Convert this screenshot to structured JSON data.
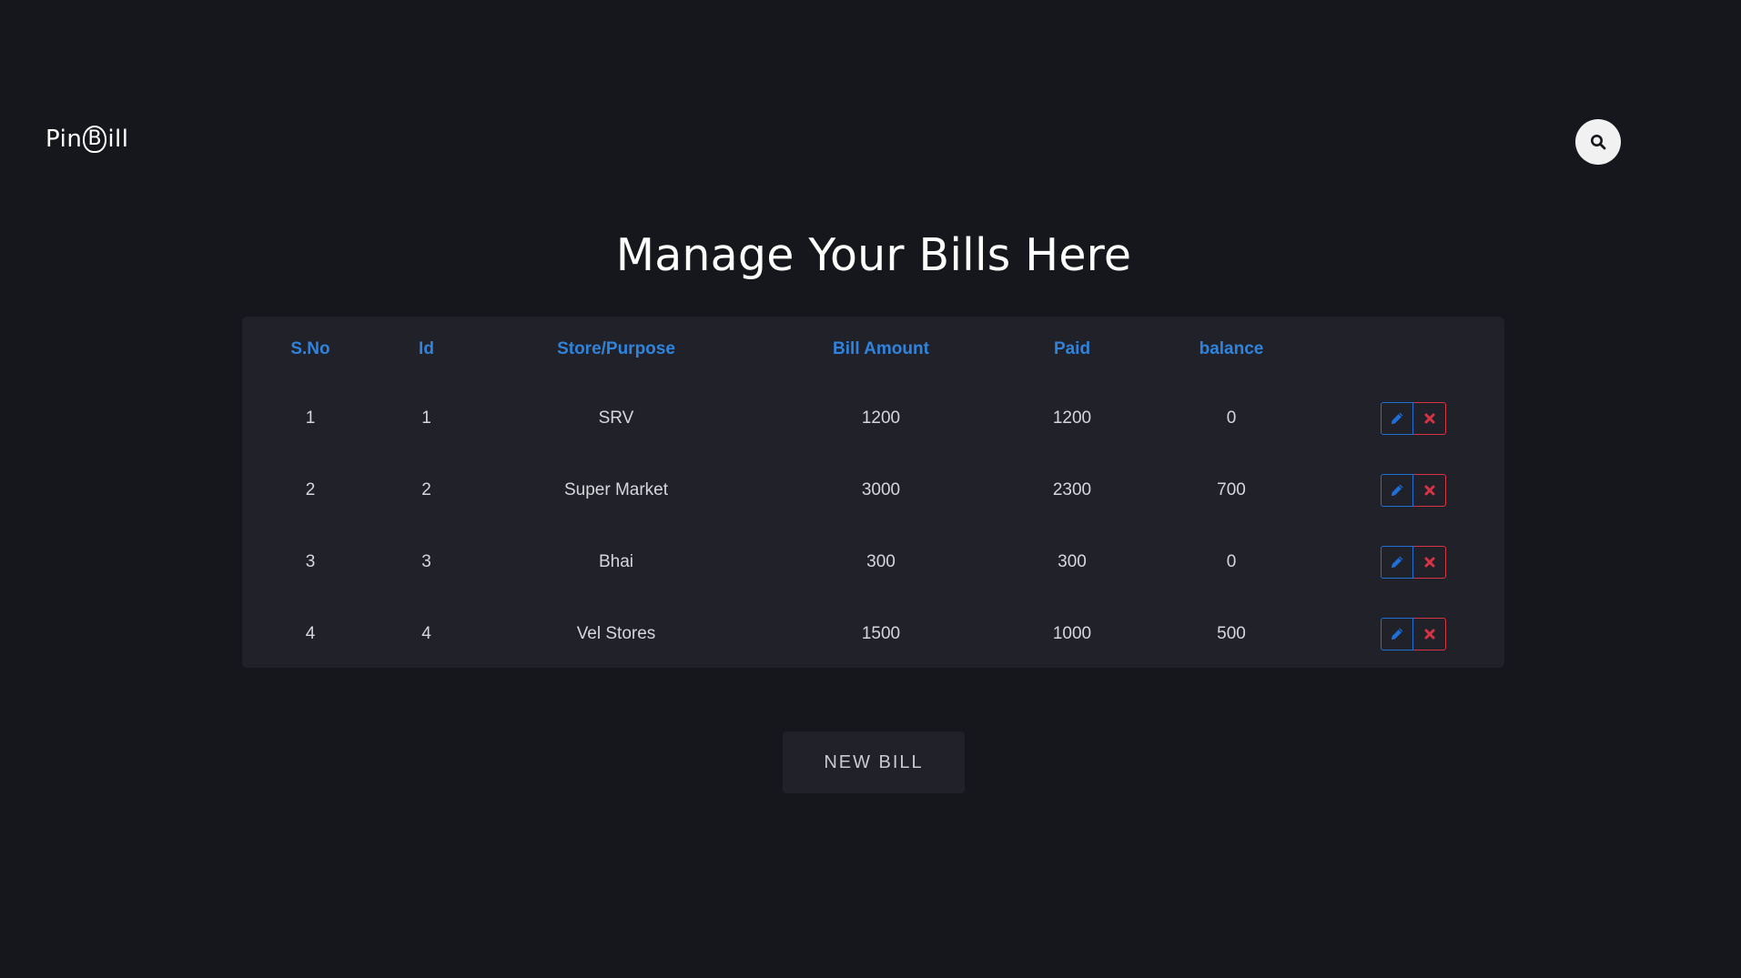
{
  "brand": {
    "prefix": "Pin",
    "b_letter": "B",
    "suffix": "ill"
  },
  "search": {
    "icon": "search-icon"
  },
  "page_title": "Manage Your Bills Here",
  "table": {
    "headers": [
      "S.No",
      "Id",
      "Store/Purpose",
      "Bill Amount",
      "Paid",
      "balance"
    ],
    "rows": [
      {
        "sno": "1",
        "id": "1",
        "store": "SRV",
        "amount": "1200",
        "paid": "1200",
        "balance": "0"
      },
      {
        "sno": "2",
        "id": "2",
        "store": "Super Market",
        "amount": "3000",
        "paid": "2300",
        "balance": "700"
      },
      {
        "sno": "3",
        "id": "3",
        "store": "Bhai",
        "amount": "300",
        "paid": "300",
        "balance": "0"
      },
      {
        "sno": "4",
        "id": "4",
        "store": "Vel Stores",
        "amount": "1500",
        "paid": "1000",
        "balance": "500"
      }
    ],
    "row_actions": {
      "edit_icon": "pencil-icon",
      "delete_icon": "close-icon"
    }
  },
  "new_bill_label": "NEW BILL",
  "colors": {
    "background": "#16171c",
    "card": "#212229",
    "header_text": "#2f83dd",
    "edit": "#1f6fd9",
    "delete": "#d63344"
  }
}
